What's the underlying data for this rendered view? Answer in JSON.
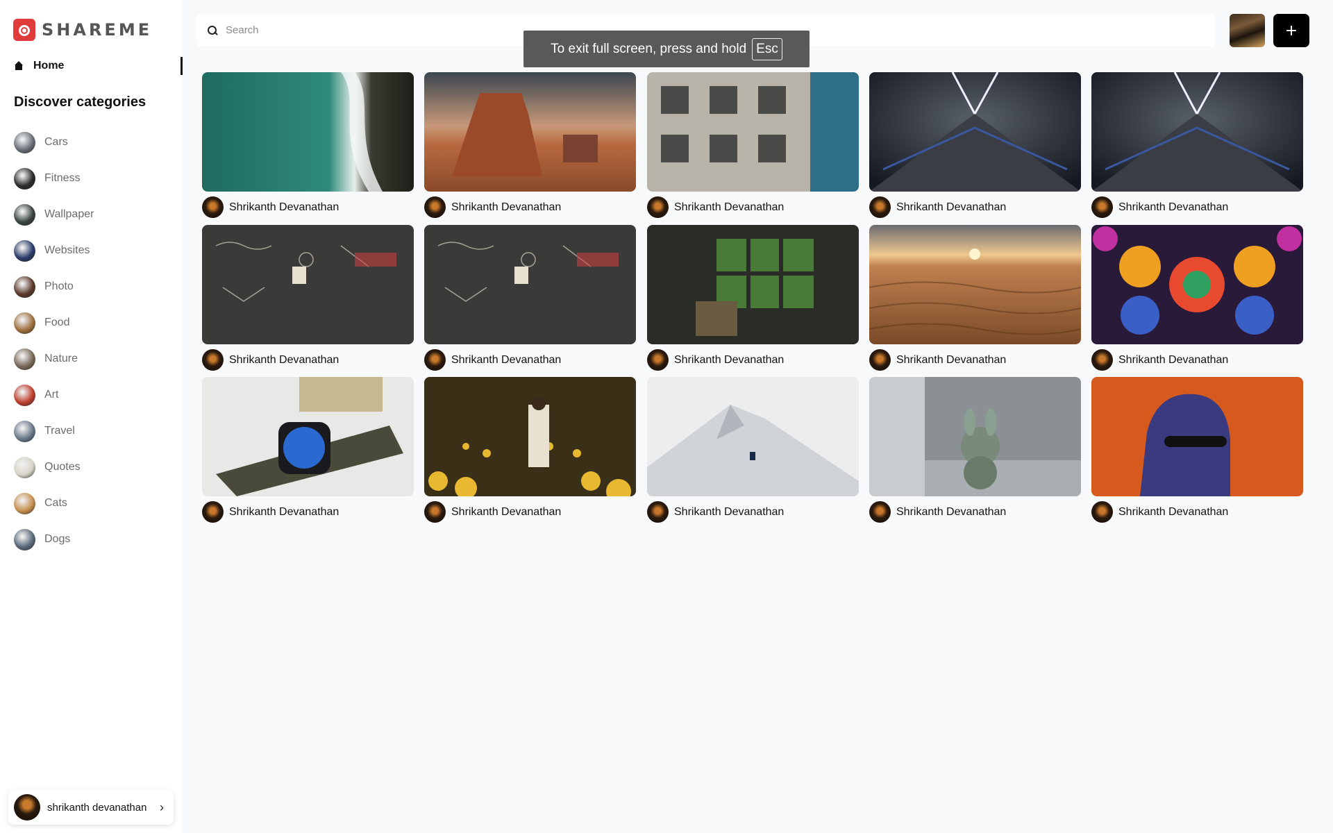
{
  "app": {
    "logo_text": "SHAREME"
  },
  "sidebar": {
    "home_label": "Home",
    "discover_title": "Discover categories",
    "categories": [
      {
        "label": "Cars",
        "color": "#6a6f78"
      },
      {
        "label": "Fitness",
        "color": "#2b2b2b"
      },
      {
        "label": "Wallpaper",
        "color": "#3a4440"
      },
      {
        "label": "Websites",
        "color": "#2a3b6a"
      },
      {
        "label": "Photo",
        "color": "#5b3a2a"
      },
      {
        "label": "Food",
        "color": "#a07040"
      },
      {
        "label": "Nature",
        "color": "#7a6a5a"
      },
      {
        "label": "Art",
        "color": "#c04030"
      },
      {
        "label": "Travel",
        "color": "#6a7a8a"
      },
      {
        "label": "Quotes",
        "color": "#d8d4c8"
      },
      {
        "label": "Cats",
        "color": "#c89050"
      },
      {
        "label": "Dogs",
        "color": "#5a6a7a"
      }
    ],
    "user": {
      "name": "shrikanth devanathan",
      "chevron": "›"
    }
  },
  "search": {
    "placeholder": "Search",
    "value": ""
  },
  "header": {
    "add_label": "+"
  },
  "fullscreen_toast": {
    "text": "To exit full screen, press and hold",
    "key": "Esc"
  },
  "pins": [
    {
      "author": "Shrikanth Devanathan",
      "icon": "ocean-aerial"
    },
    {
      "author": "Shrikanth Devanathan",
      "icon": "desert-butte"
    },
    {
      "author": "Shrikanth Devanathan",
      "icon": "building-facade"
    },
    {
      "author": "Shrikanth Devanathan",
      "icon": "tunnel"
    },
    {
      "author": "Shrikanth Devanathan",
      "icon": "tunnel"
    },
    {
      "author": "Shrikanth Devanathan",
      "icon": "chalkboard"
    },
    {
      "author": "Shrikanth Devanathan",
      "icon": "chalkboard"
    },
    {
      "author": "Shrikanth Devanathan",
      "icon": "room-window"
    },
    {
      "author": "Shrikanth Devanathan",
      "icon": "sand-sunset"
    },
    {
      "author": "Shrikanth Devanathan",
      "icon": "psychedelic-art"
    },
    {
      "author": "Shrikanth Devanathan",
      "icon": "smartwatch"
    },
    {
      "author": "Shrikanth Devanathan",
      "icon": "flower-field"
    },
    {
      "author": "Shrikanth Devanathan",
      "icon": "snow-mountain"
    },
    {
      "author": "Shrikanth Devanathan",
      "icon": "toy-window"
    },
    {
      "author": "Shrikanth Devanathan",
      "icon": "portrait-orange"
    }
  ]
}
